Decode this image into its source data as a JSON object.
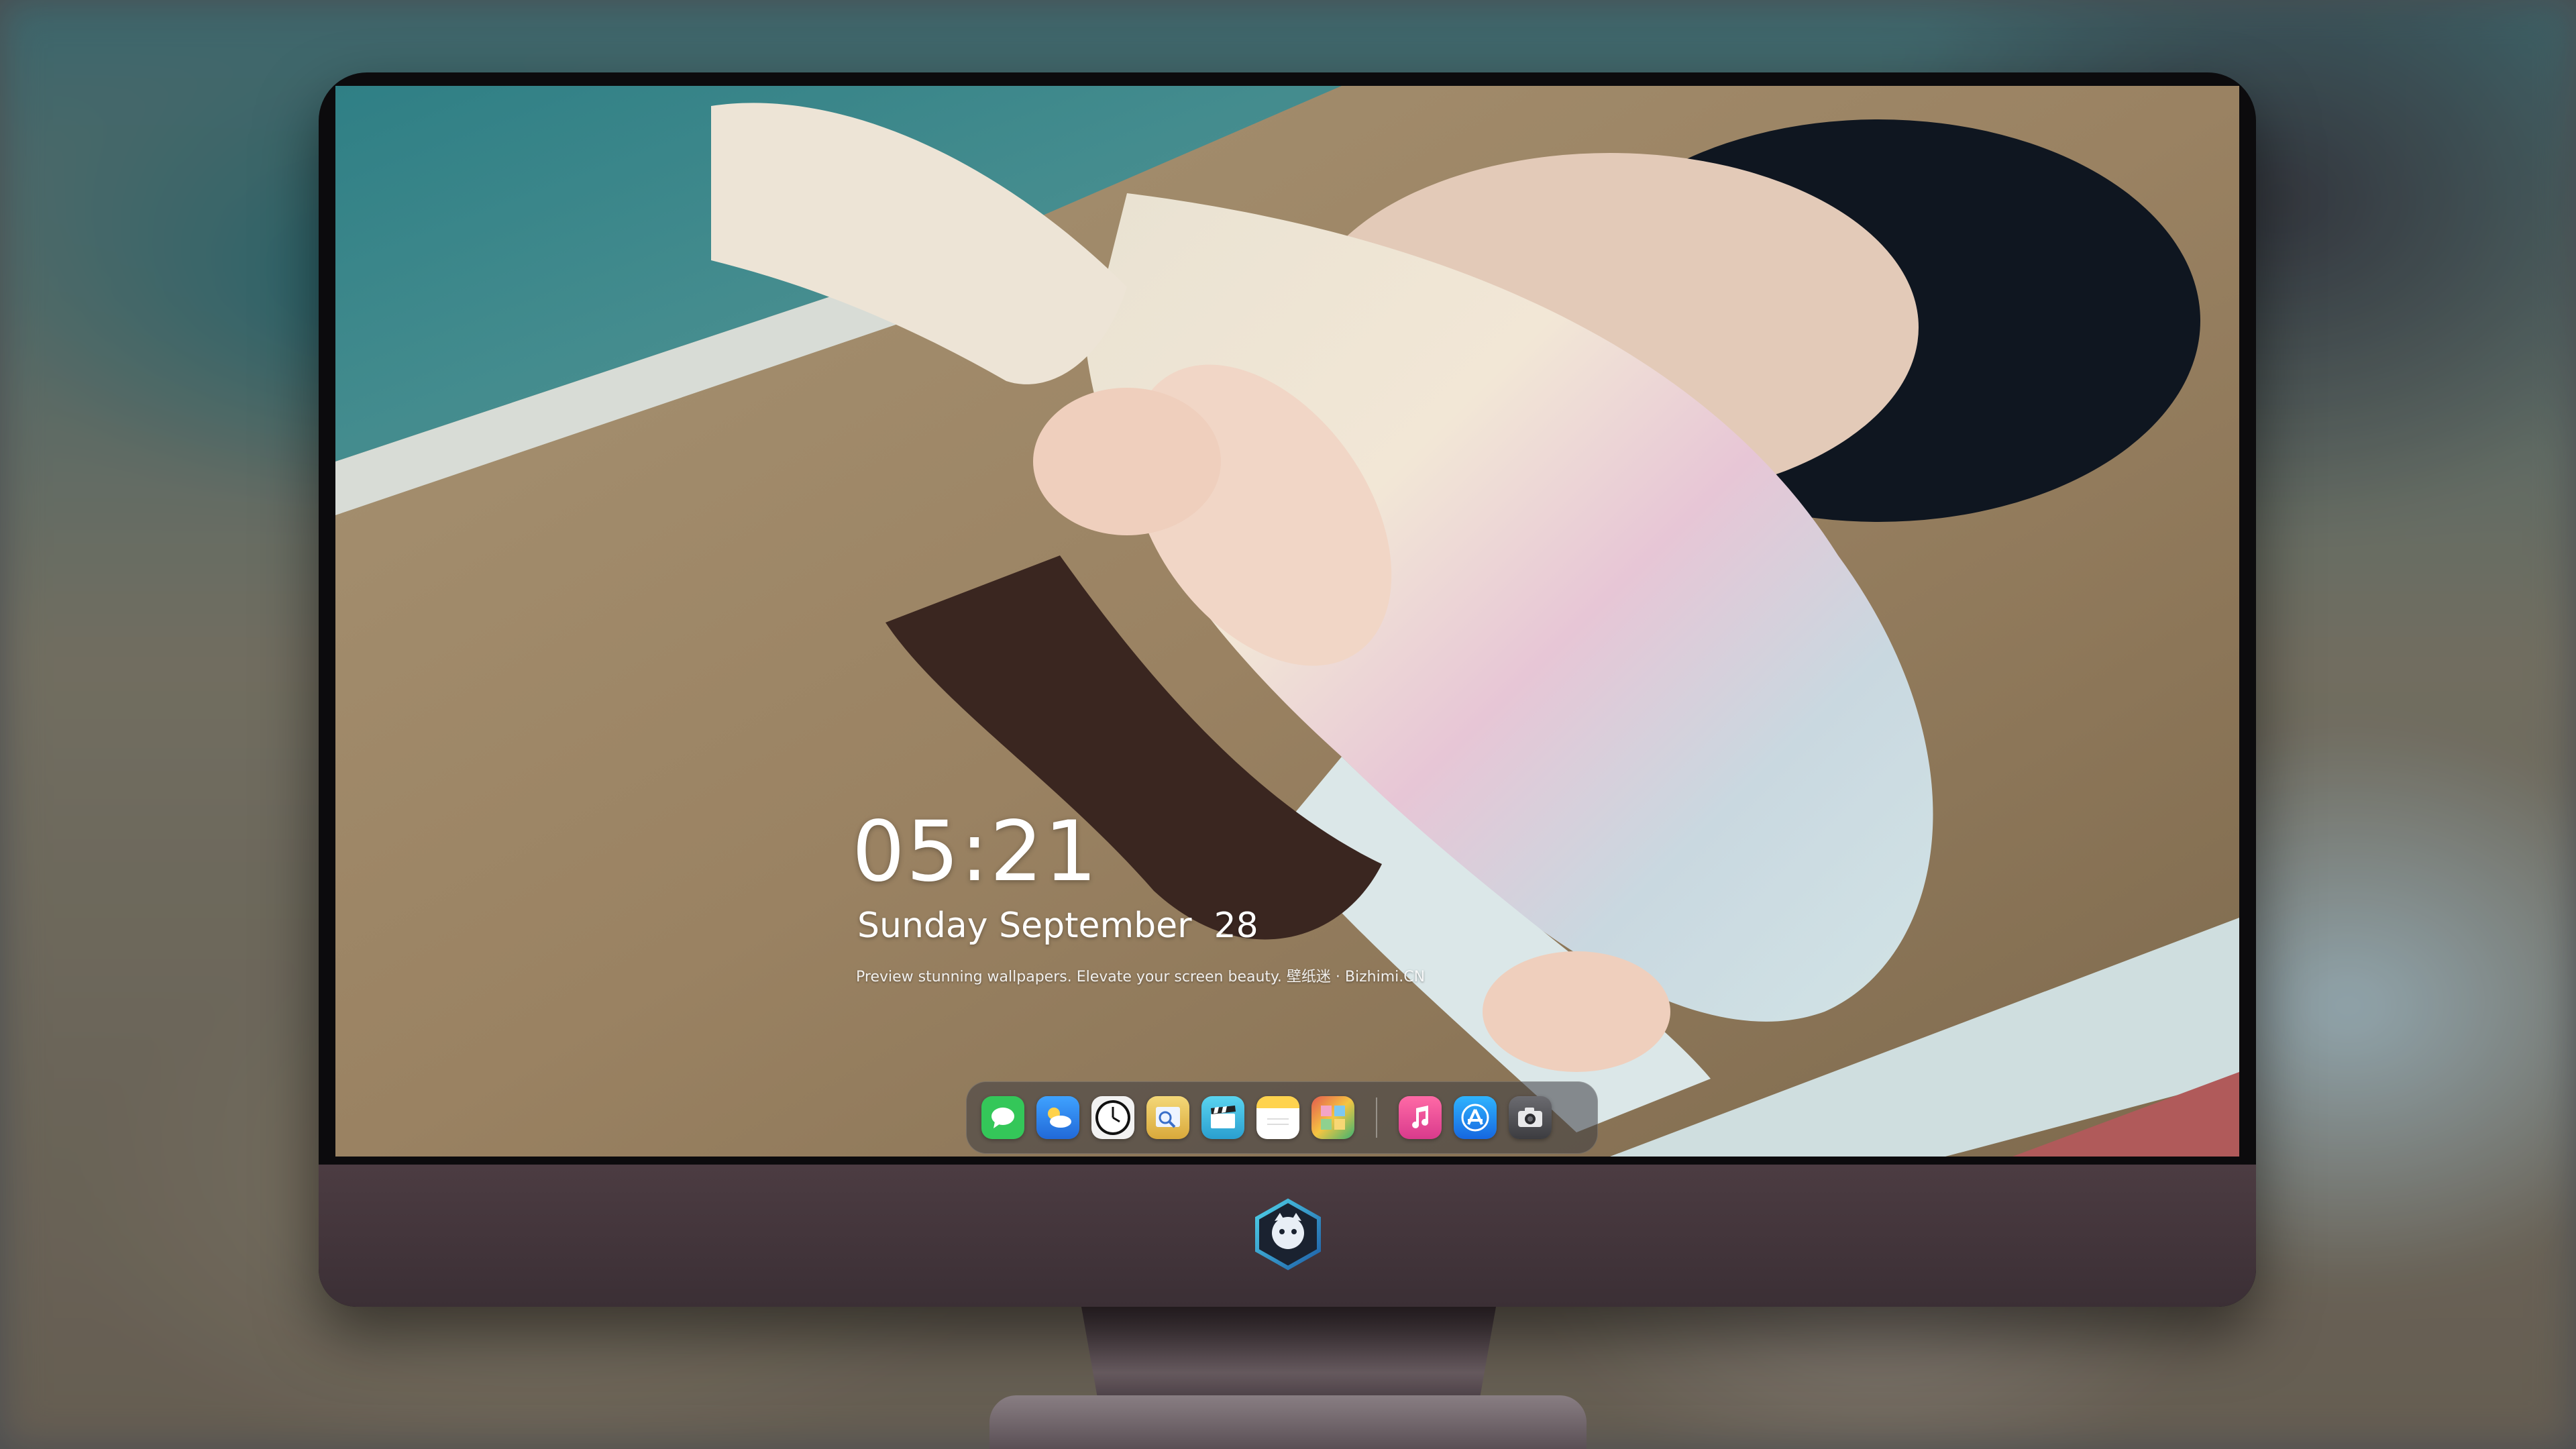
{
  "lockscreen": {
    "time": "05:21",
    "date": "Sunday September  28",
    "tagline": "Preview stunning wallpapers. Elevate your screen beauty. 壁纸迷 · Bizhimi.CN"
  },
  "dock": {
    "apps": [
      {
        "name": "Messages",
        "icon": "messages-icon",
        "color": "#34c759"
      },
      {
        "name": "Weather",
        "icon": "weather-icon",
        "color": "#3b8ff0"
      },
      {
        "name": "Clock",
        "icon": "clock-icon",
        "color": "#111111"
      },
      {
        "name": "Preview",
        "icon": "preview-icon",
        "color": "#e8c35b"
      },
      {
        "name": "Clips",
        "icon": "clapperboard-icon",
        "color": "#3fc3e6"
      },
      {
        "name": "Notes",
        "icon": "notes-icon",
        "color": "#ffd34e"
      },
      {
        "name": "Photo Booth",
        "icon": "photo-booth-icon",
        "color": "#d94f48"
      },
      {
        "name": "Music",
        "icon": "music-icon",
        "color": "#f24d8c"
      },
      {
        "name": "App Store",
        "icon": "app-store-icon",
        "color": "#1f8df0"
      },
      {
        "name": "Camera",
        "icon": "camera-icon",
        "color": "#4a4a4f"
      }
    ]
  },
  "monitor": {
    "logo": "wallpaper-site-logo"
  }
}
